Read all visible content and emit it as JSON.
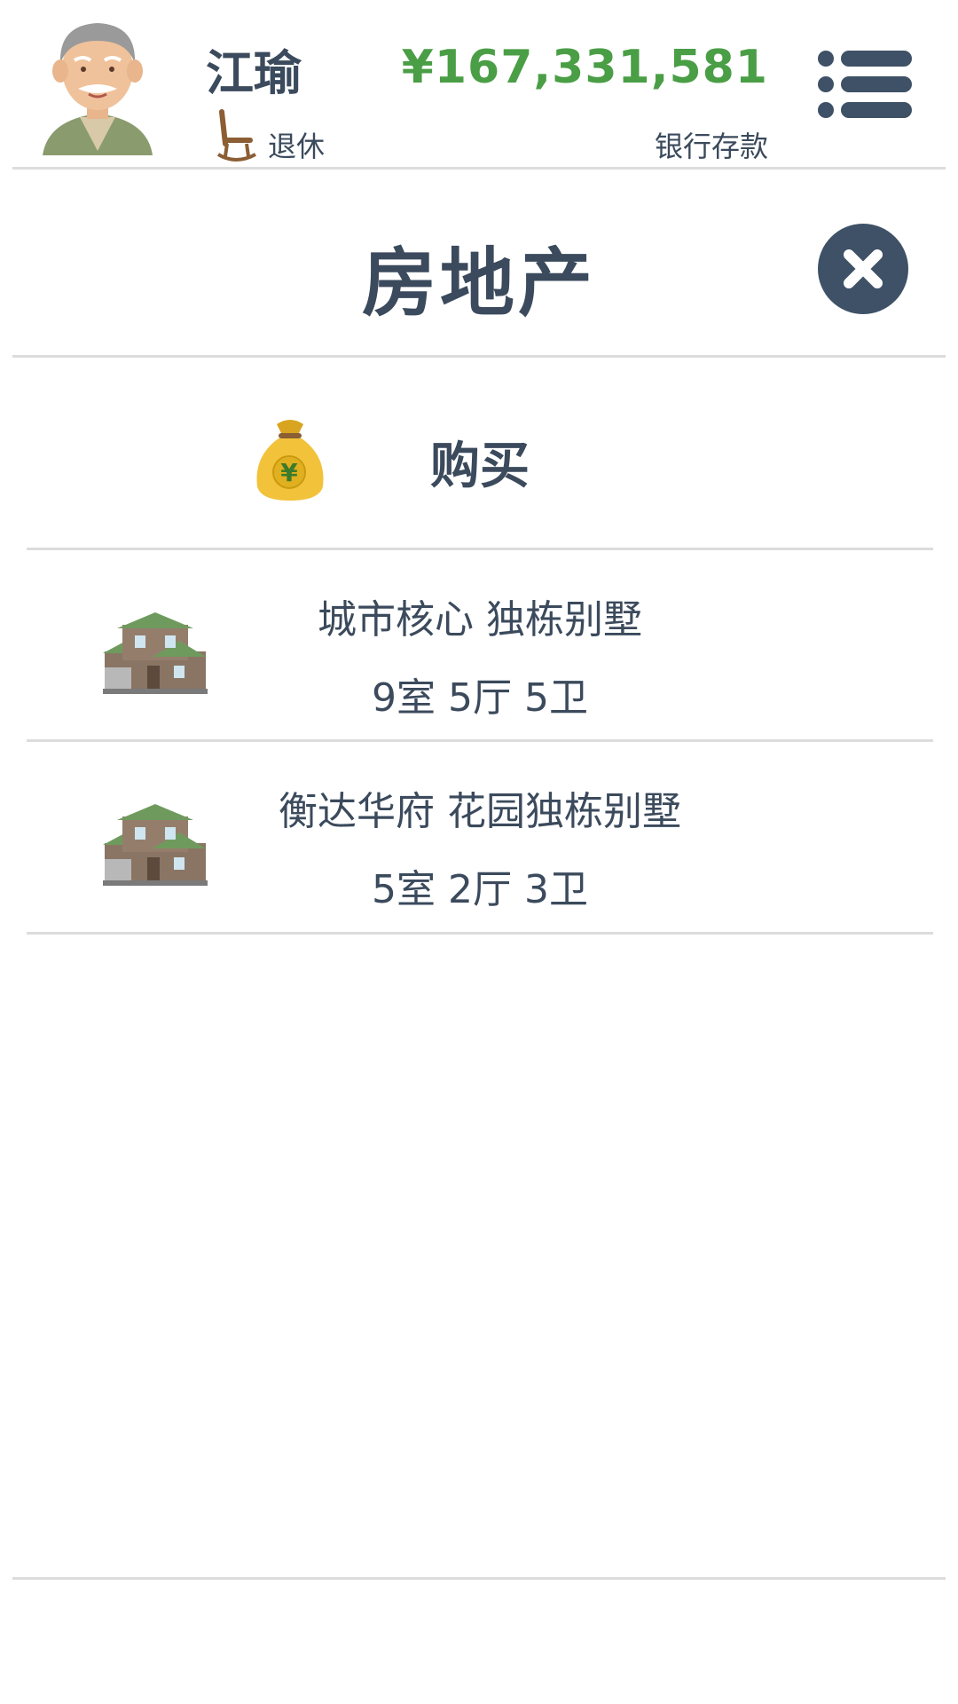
{
  "header": {
    "player_name": "江瑜",
    "status": "退休",
    "balance": "¥167,331,581",
    "balance_label": "银行存款"
  },
  "page": {
    "title": "房地产"
  },
  "buy": {
    "label": "购买"
  },
  "properties": [
    {
      "name": "城市核心 独栋别墅",
      "rooms": "9室 5厅 5卫"
    },
    {
      "name": "衡达华府 花园独栋别墅",
      "rooms": "5室 2厅 3卫"
    }
  ],
  "colors": {
    "text": "#3b4a5c",
    "balance": "#4a9e45",
    "close_button": "#3e5166"
  },
  "icons": {
    "avatar": "elderly-man-avatar",
    "status": "rocking-chair-icon",
    "menu": "menu-list-icon",
    "close": "close-icon",
    "buy": "money-bag-icon",
    "property": "house-icon"
  }
}
